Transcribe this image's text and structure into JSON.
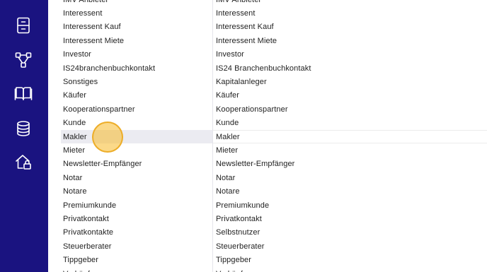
{
  "sidebar": {
    "background": "#1a1380",
    "icons": [
      {
        "name": "archive-cabinet-icon"
      },
      {
        "name": "network-nodes-icon"
      },
      {
        "name": "open-book-icon"
      },
      {
        "name": "database-icon"
      },
      {
        "name": "home-lock-icon"
      }
    ]
  },
  "left_column": {
    "items": [
      "IMV Anbieter",
      "Interessent",
      "Interessent Kauf",
      "Interessent Miete",
      "Investor",
      "IS24branchenbuchkontakt",
      "Sonstiges",
      "Käufer",
      "Kooperationspartner",
      "Kunde",
      "Makler",
      "Mieter",
      "Newsletter-Empfänger",
      "Notar",
      "Notare",
      "Premiumkunde",
      "Privatkontakt",
      "Privatkontakte",
      "Steuerberater",
      "Tippgeber",
      "Verkäufer"
    ],
    "selected_index": 10
  },
  "right_column": {
    "items": [
      "IMV Anbieter",
      "Interessent",
      "Interessent Kauf",
      "Interessent Miete",
      "Investor",
      "IS24 Branchenbuchkontakt",
      "Kapitalanleger",
      "Käufer",
      "Kooperationspartner",
      "Kunde",
      "Makler",
      "Mieter",
      "Newsletter-Empfänger",
      "Notar",
      "Notare",
      "Premiumkunde",
      "Privatkontakt",
      "Selbstnutzer",
      "Steuerberater",
      "Tippgeber",
      "Verkäufer"
    ],
    "selected_index": 10
  },
  "colors": {
    "selection_background": "#ebebf1",
    "cursor_highlight": "#f7ba28"
  }
}
